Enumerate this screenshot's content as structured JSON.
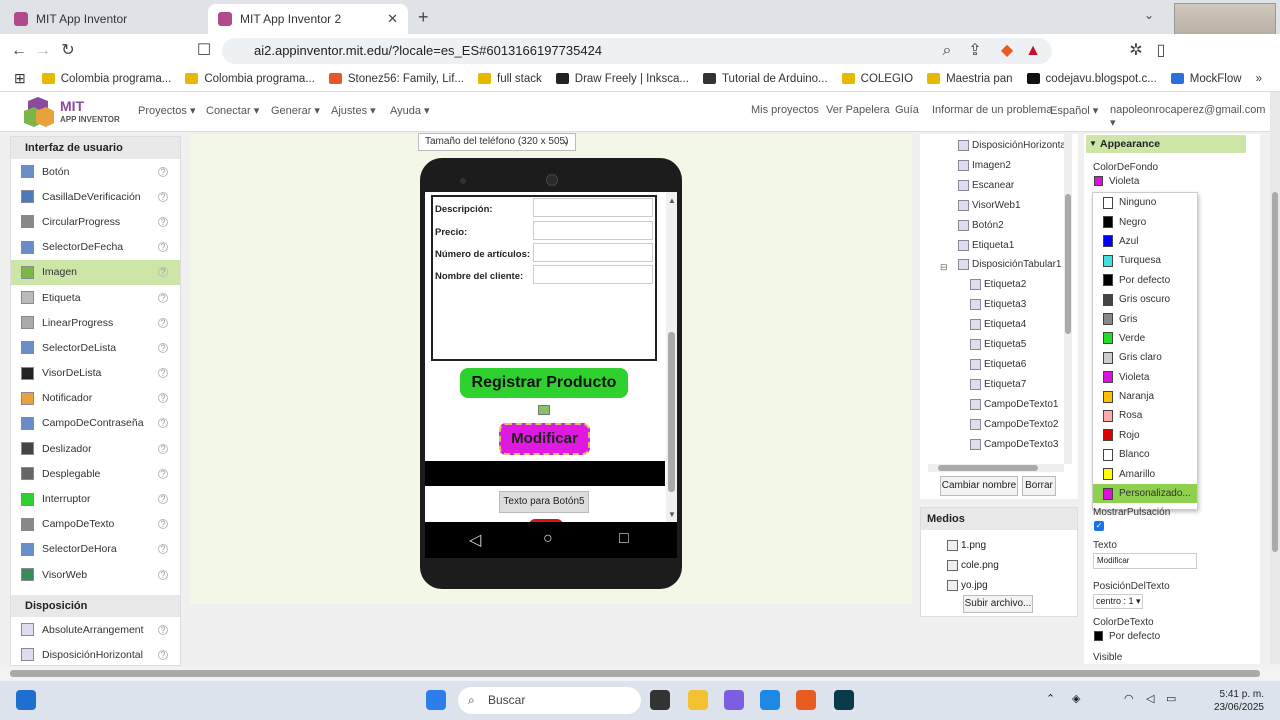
{
  "browser": {
    "tabs": [
      {
        "title": "MIT App Inventor"
      },
      {
        "title": "MIT App Inventor 2"
      }
    ],
    "url": "ai2.appinventor.mit.edu/?locale=es_ES#6013166197735424",
    "bookmarks": [
      "Colombia programa...",
      "Colombia programa...",
      "Stonez56: Family, Lif...",
      "full stack",
      "Draw Freely | Inksca...",
      "Tutorial de Arduino...",
      "COLEGIO",
      "Maestria pan",
      "codejavu.blogspot.c...",
      "MockFlow"
    ]
  },
  "header": {
    "logo_title": "MIT",
    "logo_subtitle": "APP INVENTOR",
    "menus": [
      "Proyectos ▾",
      "Conectar ▾",
      "Generar ▾",
      "Ajustes ▾",
      "Ayuda ▾"
    ],
    "right_links": [
      "Mis proyectos",
      "Ver Papelera",
      "Guía",
      "Informar de un problema",
      "Español ▾",
      "napoleonrocaperez@gmail.com ▾"
    ]
  },
  "palette": {
    "section_ui": "Interfaz de usuario",
    "items": [
      "Botón",
      "CasillaDeVerificación",
      "CircularProgress",
      "SelectorDeFecha",
      "Imagen",
      "Etiqueta",
      "LinearProgress",
      "SelectorDeLista",
      "VisorDeLista",
      "Notificador",
      "CampoDeContraseña",
      "Deslizador",
      "Desplegable",
      "Interruptor",
      "CampoDeTexto",
      "SelectorDeHora",
      "VisorWeb"
    ],
    "selected_index": 4,
    "section_layout": "Disposición",
    "layout_items": [
      "AbsoluteArrangement",
      "DisposiciónHorizontal"
    ]
  },
  "viewer": {
    "size_select": "Tamaño del teléfono (320 x 505)",
    "labels": [
      "Descripción:",
      "Precio:",
      "Número de artículos:",
      "Nombre del cliente:"
    ],
    "register_button": "Registrar Producto",
    "modify_button": "Modificar",
    "button5": "Texto para Botón5"
  },
  "components": {
    "items": [
      "DisposiciónHorizontal",
      "Imagen2",
      "Escanear",
      "VisorWeb1",
      "Botón2",
      "Etiqueta1",
      "DisposiciónTabular1",
      "Etiqueta2",
      "Etiqueta3",
      "Etiqueta4",
      "Etiqueta5",
      "Etiqueta6",
      "Etiqueta7",
      "CampoDeTexto1",
      "CampoDeTexto2",
      "CampoDeTexto3"
    ],
    "rename_button": "Cambiar nombre",
    "delete_button": "Borrar"
  },
  "media": {
    "title": "Medios",
    "files": [
      "1.png",
      "cole.png",
      "yo.jpg"
    ],
    "upload_button": "Subir archivo..."
  },
  "properties": {
    "section": "Appearance",
    "bg_color_label": "ColorDeFondo",
    "bg_color_value": "Violeta",
    "color_options": [
      {
        "name": "Ninguno",
        "color": "#ffffff"
      },
      {
        "name": "Negro",
        "color": "#000000"
      },
      {
        "name": "Azul",
        "color": "#0000ff"
      },
      {
        "name": "Turquesa",
        "color": "#40e0e0"
      },
      {
        "name": "Por defecto",
        "color": "#000000"
      },
      {
        "name": "Gris oscuro",
        "color": "#444444"
      },
      {
        "name": "Gris",
        "color": "#888888"
      },
      {
        "name": "Verde",
        "color": "#22dd22"
      },
      {
        "name": "Gris claro",
        "color": "#cccccc"
      },
      {
        "name": "Violeta",
        "color": "#dd11dd"
      },
      {
        "name": "Naranja",
        "color": "#ffc000"
      },
      {
        "name": "Rosa",
        "color": "#ffaaaa"
      },
      {
        "name": "Rojo",
        "color": "#dd0000"
      },
      {
        "name": "Blanco",
        "color": "#ffffff"
      },
      {
        "name": "Amarillo",
        "color": "#ffff00"
      },
      {
        "name": "Personalizado...",
        "color": "#dd11dd"
      }
    ],
    "show_press_label": "MostrarPulsación",
    "text_label": "Texto",
    "text_value": "Modificar",
    "text_pos_label": "PosiciónDelTexto",
    "text_pos_value": "centro : 1 ▾",
    "text_color_label": "ColorDeTexto",
    "text_color_value": "Por defecto",
    "visible_label": "Visible"
  },
  "taskbar": {
    "search_placeholder": "Buscar",
    "time": "5:41 p. m.",
    "date": "23/06/2025"
  }
}
